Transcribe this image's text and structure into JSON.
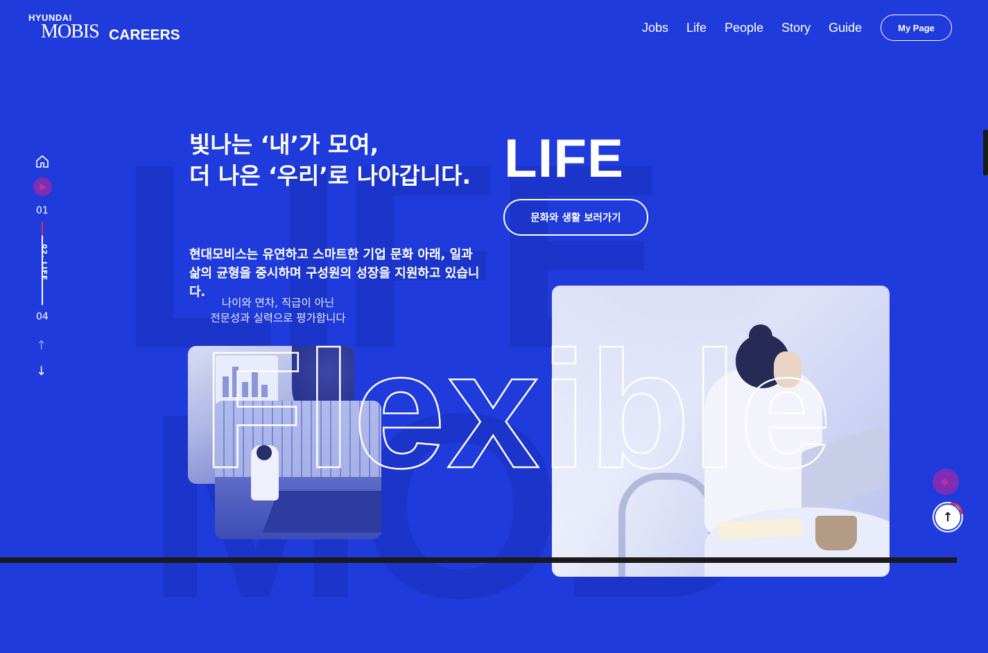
{
  "header": {
    "logo_brand": "HYUNDAI",
    "logo_mobis": "MOBIS",
    "logo_careers": "CAREERS",
    "nav": [
      "Jobs",
      "Life",
      "People",
      "Story",
      "Guide"
    ],
    "mypage_label": "My Page"
  },
  "rail": {
    "start": "01",
    "current": "02. LIFE",
    "end": "04",
    "up_arrow": "↑",
    "down_arrow": "↓",
    "icons": [
      "home-icon",
      "play-icon",
      "arrow-up-icon",
      "arrow-down-icon"
    ]
  },
  "hero": {
    "headline_line1": "빛나는 ‘내’가 모여,",
    "headline_line2": "더 나은 ‘우리’로 나아갑니다.",
    "description": "현대모비스는 유연하고 스마트한 기업 문화 아래, 일과 삶의 균형을 중시하며 구성원의 성장을 지원하고 있습니다.",
    "subcopy_line1": "나이와 연차, 직급이 아닌",
    "subcopy_line2": "전문성과 실력으로 평가합니다",
    "section_title": "LIFE",
    "cta_label": "문화와 생활 보러가기",
    "outline_word": "Flexible"
  },
  "colors": {
    "background": "#1f3bdc",
    "accent_red": "#e0334d",
    "accent_purple": "#8f2bb0"
  },
  "floating": {
    "top_button": "↑"
  }
}
